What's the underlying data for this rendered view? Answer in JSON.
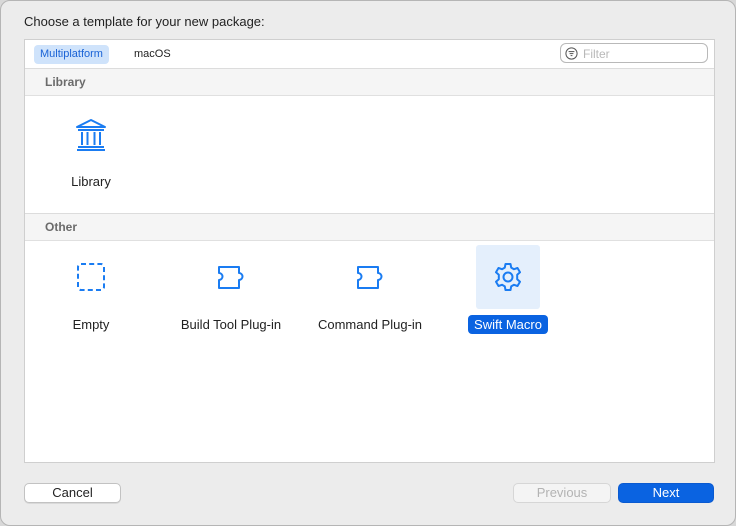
{
  "dialog": {
    "prompt": "Choose a template for your new package:"
  },
  "tabs": [
    {
      "label": "Multiplatform",
      "active": true
    },
    {
      "label": "macOS",
      "active": false
    }
  ],
  "filter": {
    "placeholder": "Filter",
    "value": ""
  },
  "sections": [
    {
      "title": "Library",
      "templates": [
        {
          "label": "Library",
          "icon": "library-icon",
          "selected": false
        }
      ]
    },
    {
      "title": "Other",
      "templates": [
        {
          "label": "Empty",
          "icon": "empty-template-icon",
          "selected": false
        },
        {
          "label": "Build Tool Plug-in",
          "icon": "puzzle-piece-icon",
          "selected": false
        },
        {
          "label": "Command Plug-in",
          "icon": "puzzle-piece-icon",
          "selected": false
        },
        {
          "label": "Swift Macro",
          "icon": "gear-icon",
          "selected": true
        }
      ]
    }
  ],
  "buttons": {
    "cancel": "Cancel",
    "previous": "Previous",
    "next": "Next"
  },
  "colors": {
    "accent": "#0a63e1",
    "icon": "#1a7cf2",
    "selection_background": "#e4effc"
  }
}
